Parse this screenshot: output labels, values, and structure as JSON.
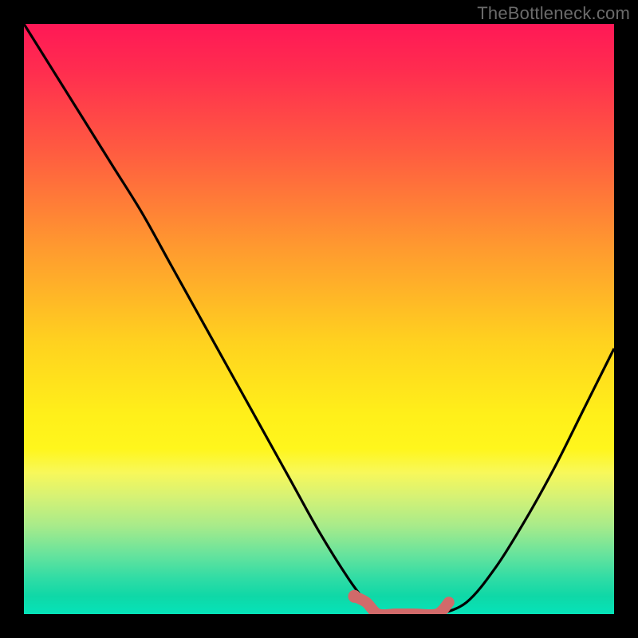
{
  "watermark": "TheBottleneck.com",
  "colors": {
    "frame": "#000000",
    "watermark": "#6b6b6b",
    "curve": "#000000",
    "highlight": "#d16a6a",
    "marker": "#d16a6a"
  },
  "chart_data": {
    "type": "line",
    "title": "",
    "xlabel": "",
    "ylabel": "",
    "xlim": [
      0,
      100
    ],
    "ylim": [
      0,
      100
    ],
    "grid": false,
    "legend": false,
    "background_gradient_notes": "vertical red→orange→yellow→green representing bottleneck fit %",
    "series": [
      {
        "name": "bottleneck-curve",
        "x": [
          0,
          5,
          10,
          15,
          20,
          25,
          30,
          35,
          40,
          45,
          50,
          55,
          58,
          60,
          63,
          66,
          70,
          75,
          80,
          85,
          90,
          95,
          100
        ],
        "y": [
          100,
          92,
          84,
          76,
          68,
          59,
          50,
          41,
          32,
          23,
          14,
          6,
          2,
          0,
          0,
          0,
          0,
          2,
          8,
          16,
          25,
          35,
          45
        ]
      }
    ],
    "highlight_segment": {
      "name": "recommended-range",
      "x": [
        56,
        58,
        60,
        63,
        66,
        70,
        72
      ],
      "y": [
        3,
        2,
        0,
        0,
        0,
        0,
        2
      ]
    },
    "marker": {
      "x": 56,
      "y": 3
    }
  }
}
